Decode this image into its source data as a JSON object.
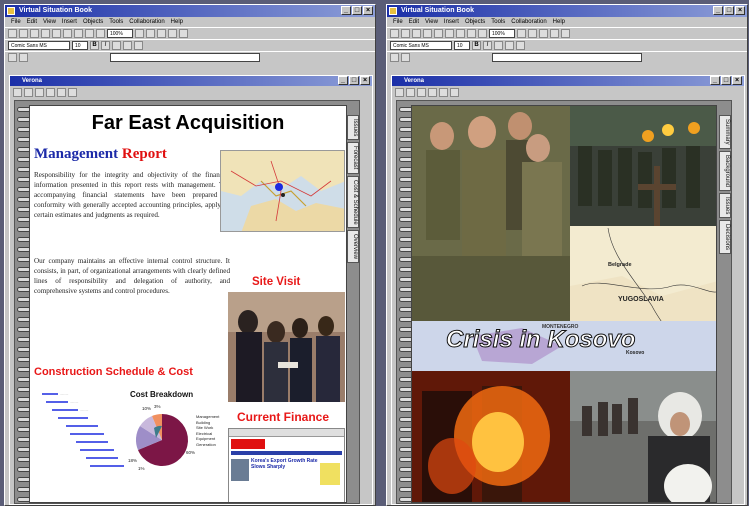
{
  "left": {
    "title": "Virtual Situation Book",
    "menu": [
      "File",
      "Edit",
      "View",
      "Insert",
      "Objects",
      "Tools",
      "Collaboration",
      "Help"
    ],
    "zoom": "100%",
    "font": "Comic Sans MS",
    "font_size": "10",
    "subwindow_title": "Verona",
    "tabs": [
      "Issues",
      "Forecast",
      "Cost & Schedule",
      "Overview"
    ],
    "page": {
      "heading": "Far East Acquisition",
      "report_a": "Management",
      "report_b": "Report",
      "para1": "Responsibility for the integrity and objectivity of the financial information presented in this report rests with management. The accompanying financial statements have been prepared in conformity with generally accepted accounting principles, applying certain estimates and judgments as required.",
      "para2": "Our company maintains an effective internal control structure. It consists, in part, of organizational arrangements with clearly defined lines of responsibility and delegation of authority, and comprehensive systems and control procedures.",
      "site_visit": "Site Visit",
      "construction": "Construction Schedule & Cost",
      "cost_breakdown": "Cost Breakdown",
      "current_finance": "Current Finance",
      "legend": [
        "Management",
        "Building",
        "Site Work",
        "Electrical",
        "Equipment",
        "Generation"
      ],
      "pie_labels": [
        "10%",
        "3%",
        "18%",
        "1%",
        "60%"
      ],
      "korea_headline": "Korea's Export Growth Rate Slows Sharply"
    }
  },
  "right": {
    "title": "Virtual Situation Book",
    "menu": [
      "File",
      "Edit",
      "View",
      "Insert",
      "Objects",
      "Tools",
      "Collaboration",
      "Help"
    ],
    "zoom": "100%",
    "font": "Comic Sans MS",
    "font_size": "10",
    "subwindow_title": "Verona",
    "tabs": [
      "Summary",
      "Background",
      "Issues",
      "Decisions"
    ],
    "collage_caption": "Crisis in Kosovo",
    "map_labels": [
      "Belgrade",
      "YUGOSLAVIA",
      "MONTENEGRO",
      "Kosovo"
    ]
  }
}
